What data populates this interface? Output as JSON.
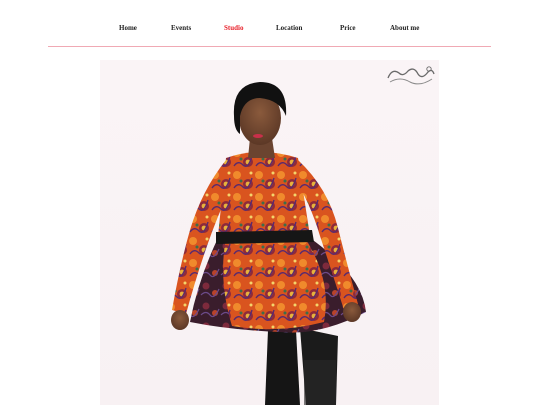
{
  "nav": {
    "items": [
      {
        "label": "Home"
      },
      {
        "label": "Events"
      },
      {
        "label": "Studio",
        "active": true
      },
      {
        "label": "Location"
      },
      {
        "label": "Price"
      },
      {
        "label": "About me"
      }
    ]
  },
  "colors": {
    "active_link": "#e8202a",
    "link": "#222222",
    "divider": "#f0a9b4",
    "photo_background": "#faf4f6"
  },
  "hero": {
    "watermark_icon": "signature-logo-icon"
  }
}
